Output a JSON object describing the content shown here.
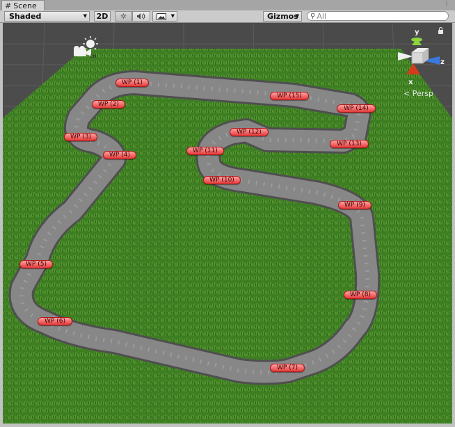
{
  "tab": {
    "title": "Scene",
    "icon": "hash-grid-icon"
  },
  "toolbar": {
    "shading_mode": "Shaded",
    "mode_2d": "2D",
    "lighting_icon": "sun-icon",
    "audio_icon": "speaker-icon",
    "effects_icon": "image-icon",
    "gizmos_label": "Gizmos",
    "search_placeholder": "All"
  },
  "gizmo": {
    "projection": "Persp",
    "axis_x": "x",
    "axis_y": "y",
    "axis_z": "z",
    "colors": {
      "x": "#d23c1c",
      "y": "#8cd43c",
      "z": "#3a7ae0"
    }
  },
  "scene": {
    "ground_color": "#3f7f22",
    "road_color": "#7a7a7a",
    "waypoints": [
      "WP (1)",
      "WP (2)",
      "WP (3)",
      "WP (4)",
      "WP (5)",
      "WP (6)",
      "WP (7)",
      "WP (8)",
      "WP (9)",
      "WP (10)",
      "WP (11)",
      "WP (12)",
      "WP (13)",
      "WP (14)",
      "WP (15)"
    ]
  }
}
